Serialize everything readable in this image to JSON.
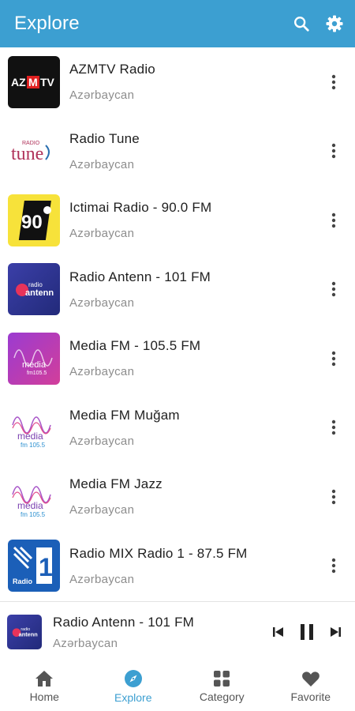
{
  "appbar": {
    "title": "Explore",
    "search_icon": "search-icon",
    "settings_icon": "gear-icon",
    "color": "#3c9fd1"
  },
  "stations": [
    {
      "name": "AZMTV Radio",
      "country": "Azərbaycan",
      "logo_text": "AZMTV"
    },
    {
      "name": "Radio Tune",
      "country": "Azərbaycan",
      "logo_text": "tune"
    },
    {
      "name": "Ictimai Radio - 90.0 FM",
      "country": "Azərbaycan",
      "logo_text": "90"
    },
    {
      "name": "Radio Antenn - 101 FM",
      "country": "Azərbaycan",
      "logo_text": "antenn"
    },
    {
      "name": "Media FM - 105.5 FM",
      "country": "Azərbaycan",
      "logo_text": "media"
    },
    {
      "name": "Media FM Muğam",
      "country": "Azərbaycan",
      "logo_text": "media"
    },
    {
      "name": "Media FM Jazz",
      "country": "Azərbaycan",
      "logo_text": "media"
    },
    {
      "name": "Radio MIX Radio 1 - 87.5 FM",
      "country": "Azərbaycan",
      "logo_text": "1"
    }
  ],
  "now_playing": {
    "name": "Radio Antenn - 101 FM",
    "country": "Azərbaycan"
  },
  "nav": [
    {
      "label": "Home",
      "icon": "home-icon"
    },
    {
      "label": "Explore",
      "icon": "compass-icon",
      "active": true
    },
    {
      "label": "Category",
      "icon": "grid-icon"
    },
    {
      "label": "Favorite",
      "icon": "heart-icon"
    }
  ]
}
